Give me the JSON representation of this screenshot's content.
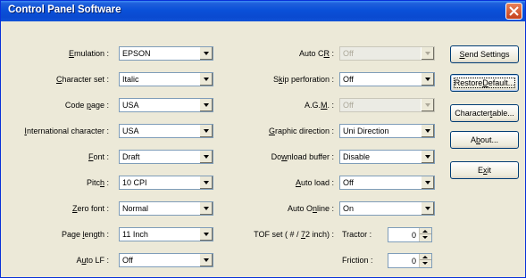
{
  "window": {
    "title": "Control Panel Software"
  },
  "left": {
    "emulation": {
      "label_pre": "",
      "label_ul": "E",
      "label_post": "mulation :",
      "value": "EPSON"
    },
    "character_set": {
      "label_pre": "",
      "label_ul": "C",
      "label_post": "haracter set :",
      "value": "Italic"
    },
    "code_page": {
      "label_pre": "Code ",
      "label_ul": "p",
      "label_post": "age :",
      "value": "USA"
    },
    "international": {
      "label_pre": "",
      "label_ul": "I",
      "label_post": "nternational character :",
      "value": "USA"
    },
    "font": {
      "label_pre": "",
      "label_ul": "F",
      "label_post": "ont :",
      "value": "Draft"
    },
    "pitch": {
      "label_pre": "Pitc",
      "label_ul": "h",
      "label_post": " :",
      "value": "10 CPI"
    },
    "zero_font": {
      "label_pre": "",
      "label_ul": "Z",
      "label_post": "ero font :",
      "value": "Normal"
    },
    "page_length": {
      "label_pre": "Page ",
      "label_ul": "l",
      "label_post": "ength :",
      "value": "11 Inch"
    },
    "auto_lf": {
      "label_pre": "A",
      "label_ul": "u",
      "label_post": "to LF :",
      "value": "Off"
    }
  },
  "right": {
    "auto_cr": {
      "label_pre": "Auto C",
      "label_ul": "R",
      "label_post": " :",
      "value": "Off"
    },
    "skip_perforation": {
      "label_pre": "S",
      "label_ul": "k",
      "label_post": "ip perforation :",
      "value": "Off"
    },
    "agm": {
      "label_pre": "A.G.",
      "label_ul": "M",
      "label_post": ". :",
      "value": "Off"
    },
    "graphic_direction": {
      "label_pre": "",
      "label_ul": "G",
      "label_post": "raphic direction :",
      "value": "Uni Direction"
    },
    "download_buffer": {
      "label_pre": "Do",
      "label_ul": "w",
      "label_post": "nload buffer :",
      "value": "Disable"
    },
    "auto_load": {
      "label_pre": "",
      "label_ul": "A",
      "label_post": "uto load :",
      "value": "Off"
    },
    "auto_online": {
      "label_pre": "Auto O",
      "label_ul": "n",
      "label_post": "line :",
      "value": "On"
    },
    "tof_set": {
      "label_pre": "TOF set ( # / ",
      "label_ul": "7",
      "label_post": "2 inch) :"
    },
    "tractor": {
      "label": "Tractor :",
      "value": "0"
    },
    "friction": {
      "label": "Friction :",
      "value": "0"
    }
  },
  "buttons": {
    "send_settings": {
      "pre": "",
      "ul": "S",
      "post": "end Settings"
    },
    "restore_default": {
      "pre": "Restore ",
      "ul": "D",
      "post": "efault..."
    },
    "character_table": {
      "pre": "Character ",
      "ul": "t",
      "post": "able..."
    },
    "about": {
      "pre": "A",
      "ul": "b",
      "post": "out..."
    },
    "exit": {
      "pre": "E",
      "ul": "x",
      "post": "it"
    }
  },
  "colors": {
    "titlebar": "#0a50d8",
    "face": "#ece9d8",
    "field_border": "#7f9db9",
    "close": "#c5401c"
  },
  "icons": {
    "close": "close-icon",
    "dropdown": "chevron-down-icon",
    "spin": "spin-up-down-icon"
  }
}
